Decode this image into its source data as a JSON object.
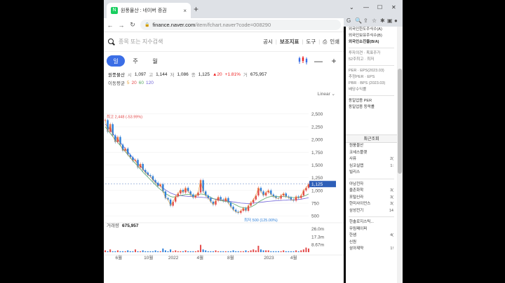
{
  "browser": {
    "tab_title": "원풍물산 : 네이버 증권",
    "favicon_text": "N",
    "tab_close": "×",
    "new_tab": "+",
    "url_host": "finance.naver.com",
    "url_path": "/item/fchart.naver?code=008290",
    "window_controls": [
      "⌄",
      "—",
      "☐",
      "✕"
    ],
    "toolbar_icons": [
      "G",
      "🔍",
      "⇪",
      "☆",
      "✱",
      "▣",
      "●",
      "⋮"
    ]
  },
  "search": {
    "placeholder": "종목 또는 지수검색"
  },
  "topmenu": [
    "공시",
    "보조지표",
    "도구",
    "인쇄"
  ],
  "periods": [
    "일",
    "주",
    "월"
  ],
  "info": {
    "name": "원풍물산",
    "open_label": "시",
    "open": "1,097",
    "high_label": "고",
    "high": "1,144",
    "low_label": "저",
    "low": "1,086",
    "close_label": "종",
    "close": "1,125",
    "change": "▲20",
    "pct": "+1.81%",
    "vol_label": "거",
    "vol": "675,957"
  },
  "ma": {
    "label": "이동평균",
    "values": [
      "5",
      "20",
      "60",
      "120"
    ],
    "colors": [
      "#e8a33c",
      "#e44c4c",
      "#5aa867",
      "#6f63d8"
    ]
  },
  "scale_label": "Linear ⌄",
  "chart_data": {
    "type": "line",
    "price_axis": [
      "2,500",
      "2,250",
      "2,000",
      "1,750",
      "1,500",
      "1,250",
      "1,000",
      "750",
      "500"
    ],
    "price_ticks": [
      2500,
      2250,
      2000,
      1750,
      1500,
      1250,
      1000,
      750,
      500
    ],
    "ylim": [
      420,
      2620
    ],
    "current_price": "1,125",
    "max_label": "최고 2,448 (-53.99%)",
    "min_label": "최저 500 (125.00%)",
    "x_labels": [
      "6월",
      "10월",
      "2022",
      "4월",
      "8월",
      "2023",
      "4월"
    ],
    "volume_label": "거래량",
    "volume_value": "675,957",
    "volume_axis": [
      "26.0m",
      "17.3m",
      "8.67m"
    ],
    "price": [
      2380,
      2150,
      2300,
      2080,
      1950,
      2050,
      1900,
      1780,
      1820,
      1700,
      1650,
      1580,
      1600,
      1450,
      1520,
      1400,
      1350,
      1300,
      1280,
      1200,
      1150,
      1080,
      1120,
      980,
      850,
      820,
      700,
      780,
      880,
      940,
      1010,
      960,
      1050,
      980,
      920,
      860,
      900,
      960,
      1200,
      980,
      900,
      850,
      780,
      720,
      800,
      870,
      820,
      790,
      850,
      760,
      680,
      620,
      580,
      560,
      600,
      650,
      600,
      700,
      760,
      820,
      900,
      1050,
      980,
      900,
      960,
      1000,
      920,
      880,
      850,
      840,
      900,
      940,
      880,
      860,
      820,
      800,
      880,
      850,
      900,
      1000,
      1050,
      1125
    ],
    "ma120": [
      2300,
      2250,
      2190,
      2120,
      2060,
      2000,
      1940,
      1880,
      1820,
      1760,
      1700,
      1640,
      1590,
      1530,
      1480,
      1420,
      1370,
      1320,
      1270,
      1220,
      1170,
      1130,
      1090,
      1050,
      1010,
      980,
      950,
      930,
      915,
      905,
      898,
      892,
      888,
      884,
      880,
      876,
      872,
      868,
      865,
      862,
      858,
      852,
      845,
      838,
      830,
      822,
      814,
      806,
      798,
      790,
      782,
      774,
      766,
      758,
      752,
      748,
      746,
      745,
      746,
      750,
      756,
      762,
      768,
      774,
      780,
      786,
      790,
      794,
      797,
      800,
      803,
      806,
      808,
      810,
      812,
      814,
      818,
      822,
      828,
      836,
      846,
      858
    ],
    "ma60": [
      2250,
      2180,
      2120,
      2060,
      2000,
      1940,
      1880,
      1820,
      1760,
      1700,
      1640,
      1580,
      1530,
      1470,
      1420,
      1360,
      1310,
      1260,
      1210,
      1160,
      1110,
      1060,
      1020,
      980,
      940,
      910,
      880,
      870,
      875,
      885,
      900,
      910,
      920,
      920,
      915,
      905,
      900,
      910,
      930,
      925,
      910,
      890,
      865,
      840,
      820,
      810,
      800,
      790,
      785,
      775,
      760,
      740,
      715,
      690,
      670,
      660,
      655,
      660,
      675,
      700,
      730,
      770,
      800,
      825,
      850,
      870,
      880,
      885,
      885,
      882,
      880,
      878,
      875,
      870,
      865,
      860,
      862,
      866,
      872,
      885,
      905,
      930
    ],
    "volume": [
      2,
      1,
      3,
      1,
      1,
      2,
      1,
      1,
      1,
      2,
      1,
      1,
      3,
      1,
      1,
      2,
      1,
      1,
      1,
      1,
      2,
      1,
      1,
      4,
      2,
      1,
      3,
      1,
      2,
      1,
      1,
      1,
      2,
      1,
      1,
      1,
      1,
      2,
      8,
      3,
      2,
      1,
      1,
      1,
      2,
      1,
      1,
      1,
      1,
      1,
      1,
      2,
      1,
      1,
      1,
      1,
      2,
      1,
      2,
      3,
      2,
      7,
      3,
      2,
      2,
      2,
      1,
      1,
      1,
      1,
      1,
      2,
      1,
      1,
      1,
      1,
      2,
      1,
      2,
      3,
      5,
      4
    ],
    "volume_max": 26
  },
  "sidepanel": {
    "top_lines": [
      "외국인한도주식수(A)",
      "외국인보유주식수(B)",
      "외국인소진율(B/A)"
    ],
    "mid_lines": [
      "투자의견 · 목표주가",
      "52주최고 · 최저"
    ],
    "per_lines": [
      "PER · EPS(2023.03)",
      "추정PER · EPS",
      "PBR · BPS (2023.03)",
      "배당수익률"
    ],
    "sector_lines": [
      "동일업종 PER",
      "동일업종 등락률"
    ],
    "recent_head": "최근조회",
    "recent1": [
      {
        "n": "원풍물산",
        "v": ""
      },
      {
        "n": "코세스플랫",
        "v": ""
      },
      {
        "n": "사퓨",
        "v": "2("
      },
      {
        "n": "심코실랩",
        "v": "1:"
      },
      {
        "n": "빌리스",
        "v": ""
      }
    ],
    "recent2": [
      {
        "n": "아남전자",
        "v": ""
      },
      {
        "n": "율촌화학",
        "v": "3("
      },
      {
        "n": "포털신라",
        "v": "3("
      },
      {
        "n": "한미사이언스",
        "v": "3("
      },
      {
        "n": "삼성전기",
        "v": "14"
      }
    ],
    "recent3": [
      {
        "n": "한솔로지스틱...",
        "v": ""
      },
      {
        "n": "무림페이퍼",
        "v": ""
      },
      {
        "n": "한샘",
        "v": "4("
      },
      {
        "n": "신원",
        "v": ""
      },
      {
        "n": "삼아제약",
        "v": "1!"
      }
    ]
  }
}
